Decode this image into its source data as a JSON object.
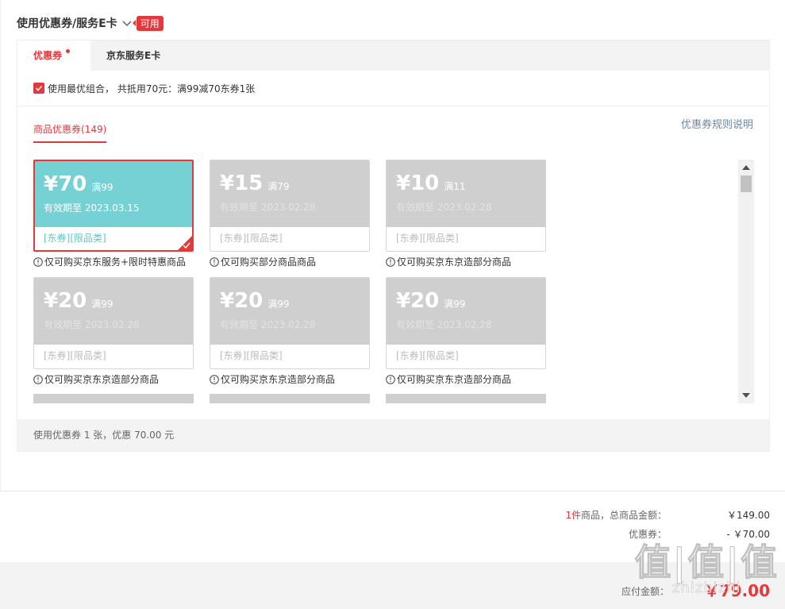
{
  "header": {
    "title": "使用优惠券/服务E卡",
    "badge": "可用"
  },
  "tabs": [
    {
      "label": "优惠券"
    },
    {
      "label": "京东服务E卡"
    }
  ],
  "combo": {
    "text": "使用最优组合， 共抵用70元：满99减70东券1张",
    "checked": true
  },
  "subtab": {
    "label": "商品优惠券(149)"
  },
  "rules_link": "优惠券规则说明",
  "coupons": [
    {
      "amount": "¥70",
      "condition": "满99",
      "validity": "有效期至 2023.03.15",
      "tag": "[东券][限品类]",
      "note": "仅可购买京东服务+限时特惠商品"
    },
    {
      "amount": "¥15",
      "condition": "满79",
      "validity": "有效期至 2023.02.28",
      "tag": "[东券][限品类]",
      "note": "仅可购买部分商品商品"
    },
    {
      "amount": "¥10",
      "condition": "满11",
      "validity": "有效期至 2023.02.28",
      "tag": "[东券][限品类]",
      "note": "仅可购买京东京造部分商品"
    },
    {
      "amount": "¥20",
      "condition": "满99",
      "validity": "有效期至 2023.02.28",
      "tag": "[东券][限品类]",
      "note": "仅可购买京东京造部分商品"
    },
    {
      "amount": "¥20",
      "condition": "满99",
      "validity": "有效期至 2023.02.28",
      "tag": "[东券][限品类]",
      "note": "仅可购买京东京造部分商品"
    },
    {
      "amount": "¥20",
      "condition": "满99",
      "validity": "有效期至 2023.02.28",
      "tag": "[东券][限品类]",
      "note": "仅可购买京东京造部分商品"
    }
  ],
  "summary": "使用优惠券 1 张，优惠 70.00 元",
  "totals": {
    "qty": "1件",
    "items_label": "商品，总商品金额：",
    "items_value": "￥149.00",
    "coupon_label": "优惠券：",
    "coupon_value": "- ￥70.00"
  },
  "pay": {
    "label": "应付金额：",
    "amount": "￥79.00"
  },
  "watermark": {
    "big": "值|值|值",
    "small": "zhizhizhi"
  },
  "colors": {
    "accent": "#e4393c",
    "coupon_active": "#76d1d5",
    "coupon_disabled": "#cfcfcf",
    "link": "#6b86a8"
  }
}
